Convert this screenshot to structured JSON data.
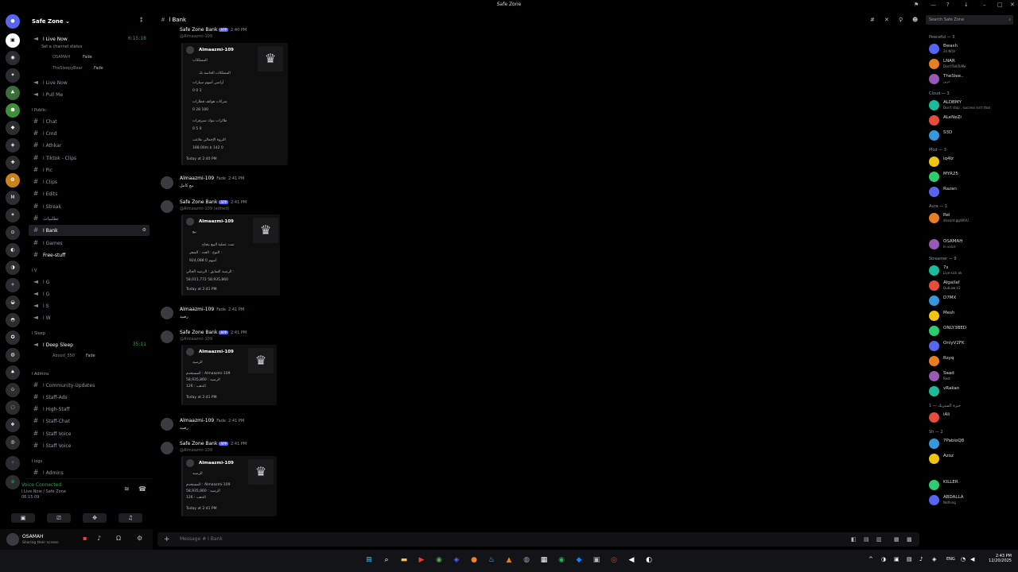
{
  "window": {
    "title": "Safe Zone"
  },
  "server": {
    "name": "Safe Zone"
  },
  "channels": {
    "live_now_1": "ا Live Now",
    "live_now_time": "6:15:18",
    "status_prompt": "Set a channel status",
    "live_users": [
      "OSAMAH",
      "TheSleepyBear"
    ],
    "live_badge": "Fade",
    "live_now_2": "ا Live Now",
    "pull_me": "ا Pull Me",
    "cat_public": "ا Public",
    "list": [
      "ا Chat",
      "ا Cmd",
      "ا Athkar",
      "ا Tiktok - Clips",
      "ا Pic",
      "ا Clips",
      "ا Edits",
      "ا Streak",
      "تطلبيات",
      "ا Bank",
      "ا Games",
      "Free-stuff"
    ],
    "cat_v": "ا V",
    "vlist": [
      "ا G",
      "ا G",
      "ا S",
      "ا W"
    ],
    "cat_sleep": "ا Sleep",
    "deep_sleep": "ا Deep Sleep",
    "deep_sleep_time": "35:11",
    "deep_user": "Abood_350",
    "cat_admins": "ا Admins",
    "admin_list": [
      "ا Community-Updates",
      "ا Staff-Ads",
      "ا High-Staff",
      "ا Staff-Chat",
      "ا Staff Voice",
      "ا Staff Voice"
    ],
    "cat_logs": "ا logs",
    "logs_list": [
      "ا Admins"
    ]
  },
  "voice": {
    "status": "Voice Connected",
    "where": "ا Live Now / Safe Zone",
    "time": "06:15:09"
  },
  "user": {
    "name": "OSAMAH",
    "status": "Sharing their screen"
  },
  "channel_header": {
    "name": "ا Bank"
  },
  "messages": [
    {
      "author": "Safe Zone Bank",
      "tag": "APP",
      "time": "2:40 PM",
      "sub": "@Almaazmi-109",
      "embed": {
        "title": "Almaazmi-109",
        "subtitle": "الممتلكات",
        "lines": [
          "الممتلكات الخاصة بك",
          "أراضي   أسهم   سيارات",
          "0   0   1",
          "شركات   هواتف   قطارات",
          "0   28   100",
          "طائرات   بنوك   سيرفرات",
          "0   5   0",
          "الثروة   الإجمالي   ملاعب",
          "188.00m $   142   0"
        ],
        "footer": "Today at 2:40 PM"
      }
    },
    {
      "author": "Almaazmi-109",
      "badge": "Fade",
      "time": "2:41 PM",
      "text": "بيع كامل"
    },
    {
      "author": "Safe Zone Bank",
      "tag": "APP",
      "time": "2:41 PM",
      "sub": "@Almaazmi-109 (edited)",
      "embed": {
        "title": "Almaazmi-109",
        "subtitle": "بيع",
        "lines": [
          "تمت عملية البيع بنجاح",
          "النوع :   العدد :   السعر :",
          "أسهم   0   924,088",
          "الرصيد السابق :   الرصيد الحالي :",
          "58,011,772   58,935,860"
        ],
        "footer": "Today at 2:41 PM"
      }
    },
    {
      "author": "Almaazmi-109",
      "badge": "Fade",
      "time": "2:41 PM",
      "text": "رصيد"
    },
    {
      "author": "Safe Zone Bank",
      "tag": "APP",
      "time": "2:41 PM",
      "sub": "@Almaazmi-109",
      "embed": {
        "title": "Almaazmi-109",
        "subtitle": "الرصيد",
        "lines": [
          "المستخدم : Almaazmi-109",
          "الرصيد : 58,935,860",
          "الذهب : 126"
        ],
        "footer": "Today at 2:41 PM"
      }
    },
    {
      "author": "Almaazmi-109",
      "badge": "Fade",
      "time": "2:41 PM",
      "text": "رصيد"
    },
    {
      "author": "Safe Zone Bank",
      "tag": "APP",
      "time": "2:41 PM",
      "sub": "@Almaazmi-109",
      "embed": {
        "title": "Almaazmi-109",
        "subtitle": "الرصيد",
        "lines": [
          "المستخدم : Almaazmi-109",
          "الرصيد : 58,935,860",
          "الذهب : 126"
        ],
        "footer": "Today at 2:41 PM"
      }
    }
  ],
  "composer": {
    "placeholder": "Message # ا Bank"
  },
  "members": {
    "search": "Search Safe Zone",
    "groups": [
      {
        "label": "Peaceful — 3",
        "items": [
          {
            "n": "Bwash",
            "s": "24 NOV"
          },
          {
            "n": "LNAR",
            "s": "Don'tTalkToMe"
          },
          {
            "n": "TheSlee..",
            "s": "حزين"
          }
        ]
      },
      {
        "label": "Cloud — 3",
        "items": [
          {
            "n": "ALDBMY",
            "s": "Don't stop , success isn't that"
          },
          {
            "n": "ALeNeZi",
            "s": ""
          },
          {
            "n": "S3D",
            "s": ""
          }
        ]
      },
      {
        "label": "Mod — 3",
        "items": [
          {
            "n": "iq4lz",
            "s": ""
          },
          {
            "n": "MYR25",
            "s": ""
          },
          {
            "n": "Razan",
            "s": ""
          }
        ]
      },
      {
        "label": "Aura — 1",
        "items": [
          {
            "n": "Rel",
            "s": "discord.gg/WUU"
          }
        ]
      },
      {
        "label": "",
        "items": [
          {
            "n": "OSAMAH",
            "s": "In voice"
          }
        ]
      },
      {
        "label": "Streamer — 9",
        "items": [
          {
            "n": "7s",
            "s": "Live kick ok"
          },
          {
            "n": "Algallaf",
            "s": "OutLaw V2"
          },
          {
            "n": "D7MX",
            "s": ""
          },
          {
            "n": "Mesh",
            "s": ""
          },
          {
            "n": "ONLY3BED",
            "s": ""
          },
          {
            "n": "OnlyV2FK",
            "s": ""
          },
          {
            "n": "Rsyq",
            "s": ""
          },
          {
            "n": "Saad",
            "s": "Rest"
          },
          {
            "n": "vRakan",
            "s": ""
          }
        ]
      },
      {
        "label": "1 — خيرة الستريك",
        "items": [
          {
            "n": "iAli",
            "s": ""
          }
        ]
      },
      {
        "label": "Sh — 2",
        "items": [
          {
            "n": "7PabloQ8",
            "s": ""
          },
          {
            "n": "Azoz",
            "s": ""
          }
        ]
      },
      {
        "label": "",
        "items": [
          {
            "n": "KILLER",
            "s": ""
          },
          {
            "n": "ABDALLA",
            "s": "Nothing"
          }
        ]
      }
    ]
  },
  "taskbar": {
    "lang": "ENG",
    "time": "2:43 PM",
    "date": "12/20/2025"
  }
}
